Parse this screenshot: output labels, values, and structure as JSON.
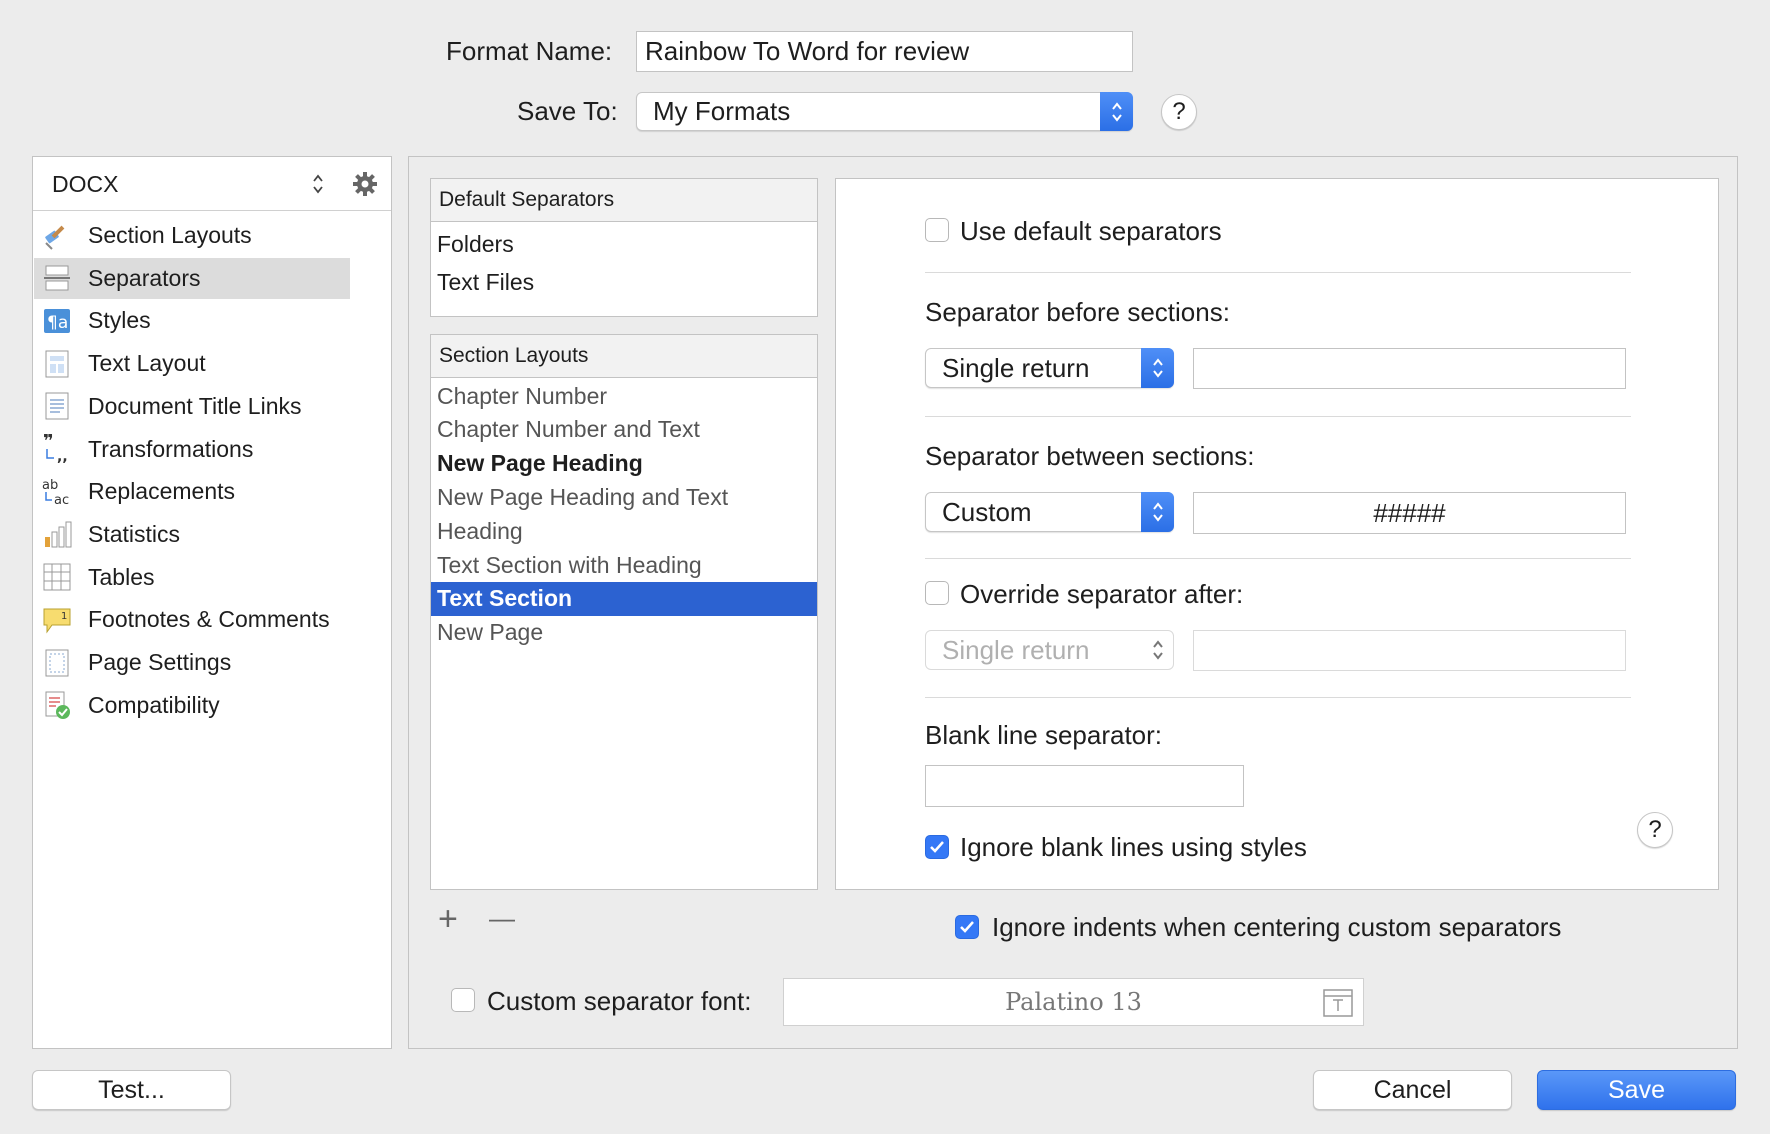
{
  "header": {
    "format_name_label": "Format Name:",
    "format_name_value": "Rainbow To Word for review",
    "save_to_label": "Save To:",
    "save_to_value": "My Formats",
    "help": "?"
  },
  "sidebar": {
    "title": "DOCX",
    "items": [
      {
        "label": "Section Layouts",
        "icon": "brush-icon"
      },
      {
        "label": "Separators",
        "icon": "separator-icon",
        "selected": true
      },
      {
        "label": "Styles",
        "icon": "styles-icon"
      },
      {
        "label": "Text Layout",
        "icon": "text-layout-icon"
      },
      {
        "label": "Document Title Links",
        "icon": "document-icon"
      },
      {
        "label": "Transformations",
        "icon": "quotes-icon"
      },
      {
        "label": "Replacements",
        "icon": "replace-icon"
      },
      {
        "label": "Statistics",
        "icon": "bar-chart-icon"
      },
      {
        "label": "Tables",
        "icon": "table-icon"
      },
      {
        "label": "Footnotes & Comments",
        "icon": "footnote-icon"
      },
      {
        "label": "Page Settings",
        "icon": "page-settings-icon"
      },
      {
        "label": "Compatibility",
        "icon": "compatibility-icon"
      }
    ]
  },
  "default_separators": {
    "header": "Default Separators",
    "rows": [
      "Folders",
      "Text Files"
    ]
  },
  "section_layouts": {
    "header": "Section Layouts",
    "rows": [
      {
        "label": "Chapter Number",
        "style": "light"
      },
      {
        "label": "Chapter Number and Text",
        "style": "light"
      },
      {
        "label": "New Page Heading",
        "style": "bold"
      },
      {
        "label": "New Page Heading and Text",
        "style": "light"
      },
      {
        "label": "Heading",
        "style": "light"
      },
      {
        "label": "Text Section with Heading",
        "style": "light"
      },
      {
        "label": "Text Section",
        "style": "selected"
      },
      {
        "label": "New Page",
        "style": "light"
      }
    ],
    "add": "+",
    "remove": "—"
  },
  "options": {
    "use_default_label": "Use default separators",
    "before_label": "Separator before sections:",
    "before_value": "Single return",
    "before_custom": "",
    "between_label": "Separator between sections:",
    "between_value": "Custom",
    "between_custom": "#####",
    "override_label": "Override separator after:",
    "override_value": "Single return",
    "override_custom": "",
    "blank_label": "Blank line separator:",
    "blank_value": "",
    "ignore_blank_label": "Ignore blank lines using styles",
    "help": "?"
  },
  "footer_options": {
    "ignore_indents_label": "Ignore indents when centering custom separators",
    "custom_font_label": "Custom separator font:",
    "font_value": "Palatino 13"
  },
  "buttons": {
    "test": "Test...",
    "cancel": "Cancel",
    "save": "Save"
  },
  "colors": {
    "accent": "#2c62d1",
    "button_blue": "#3478f6"
  }
}
